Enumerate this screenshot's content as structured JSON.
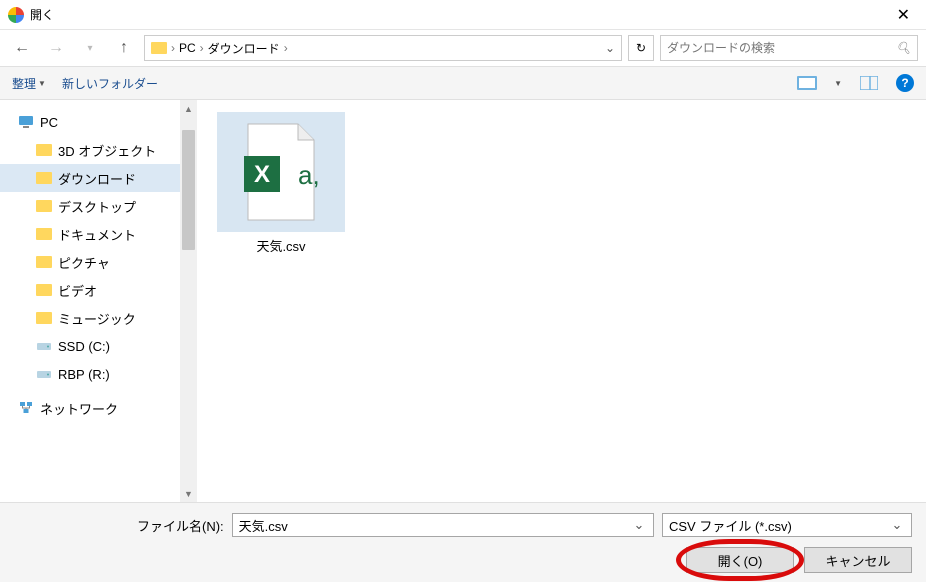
{
  "title": "開く",
  "breadcrumb": {
    "root": "PC",
    "folder": "ダウンロード"
  },
  "search": {
    "placeholder": "ダウンロードの検索"
  },
  "toolbar": {
    "organize": "整理",
    "newfolder": "新しいフォルダー"
  },
  "tree": {
    "pc": "PC",
    "items": [
      {
        "label": "3D オブジェクト"
      },
      {
        "label": "ダウンロード"
      },
      {
        "label": "デスクトップ"
      },
      {
        "label": "ドキュメント"
      },
      {
        "label": "ピクチャ"
      },
      {
        "label": "ビデオ"
      },
      {
        "label": "ミュージック"
      }
    ],
    "ssd": "SSD (C:)",
    "rbp": "RBP (R:)",
    "network": "ネットワーク"
  },
  "file": {
    "name": "天気.csv"
  },
  "bottom": {
    "filename_label": "ファイル名(N):",
    "filename_value": "天気.csv",
    "filter": "CSV ファイル (*.csv)",
    "open": "開く(O)",
    "cancel": "キャンセル"
  }
}
